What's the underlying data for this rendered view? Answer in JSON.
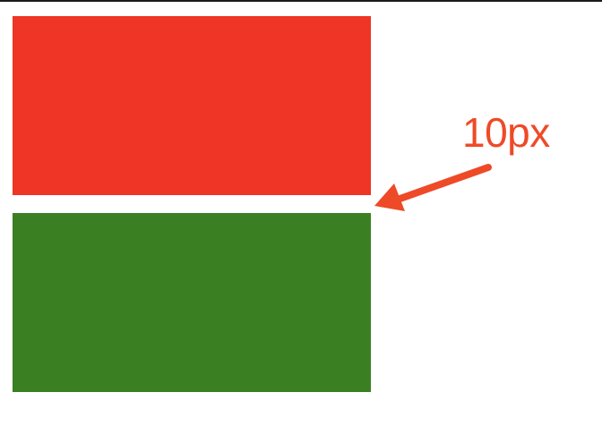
{
  "annotation": {
    "label": "10px",
    "color": "#ee4a28"
  },
  "boxes": {
    "top": {
      "color": "#ef3526"
    },
    "bottom": {
      "color": "#3b7f23"
    }
  },
  "frame": {
    "border_color": "#1a1a1a"
  }
}
